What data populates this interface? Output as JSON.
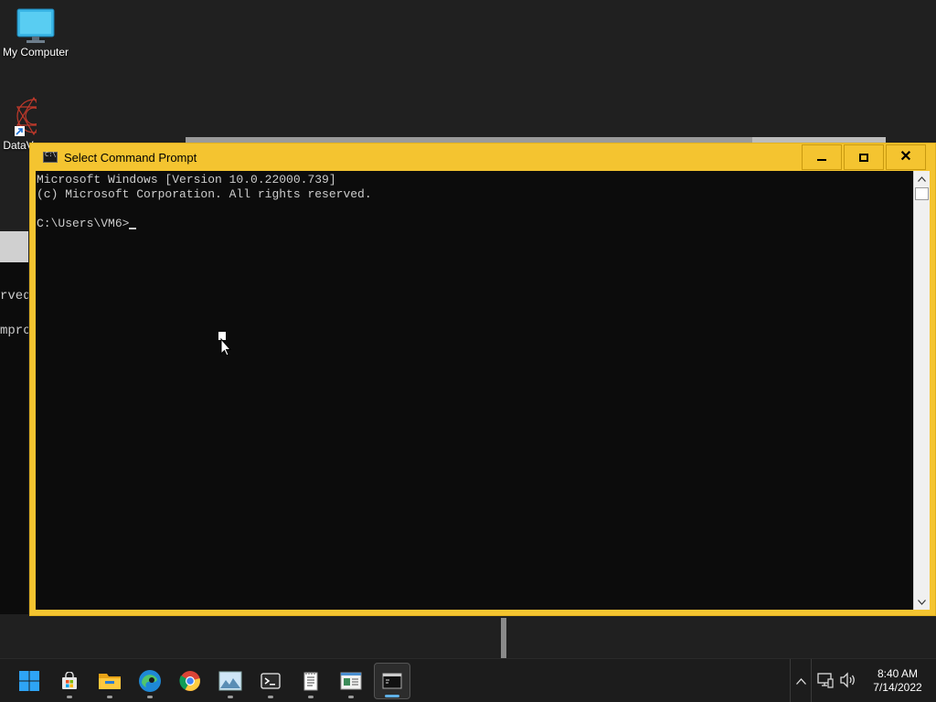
{
  "desktop": {
    "icons": [
      {
        "label": "My Computer",
        "icon": "monitor-icon"
      },
      {
        "label": "DataV",
        "icon": "datav-app-icon"
      }
    ],
    "background_console_fragments": [
      "rved",
      "mpro"
    ]
  },
  "cmd_window": {
    "title": "Select Command Prompt",
    "buttons": {
      "minimize": "minimize",
      "maximize": "maximize",
      "close": "close"
    },
    "console_lines": [
      "Microsoft Windows [Version 10.0.22000.739]",
      "(c) Microsoft Corporation. All rights reserved.",
      "",
      "C:\\Users\\VM6>"
    ],
    "accent_color": "#f4c430",
    "console_bg": "#0c0c0c",
    "console_fg": "#cccccc"
  },
  "taskbar": {
    "apps": [
      {
        "name": "start",
        "icon": "windows-start-icon"
      },
      {
        "name": "store",
        "icon": "store-bag-icon"
      },
      {
        "name": "file-explorer",
        "icon": "folder-icon"
      },
      {
        "name": "edge",
        "icon": "edge-icon"
      },
      {
        "name": "chrome",
        "icon": "chrome-icon"
      },
      {
        "name": "photos",
        "icon": "image-icon"
      },
      {
        "name": "terminal",
        "icon": "terminal-icon"
      },
      {
        "name": "notepad",
        "icon": "notepad-icon"
      },
      {
        "name": "wordpad",
        "icon": "document-icon"
      },
      {
        "name": "command-prompt",
        "icon": "cmd-icon",
        "active": true
      }
    ],
    "tray": {
      "chevron": "^",
      "network_icon": "network-icon",
      "volume_icon": "volume-icon"
    },
    "clock": {
      "time": "8:40 AM",
      "date": "7/14/2022"
    }
  }
}
